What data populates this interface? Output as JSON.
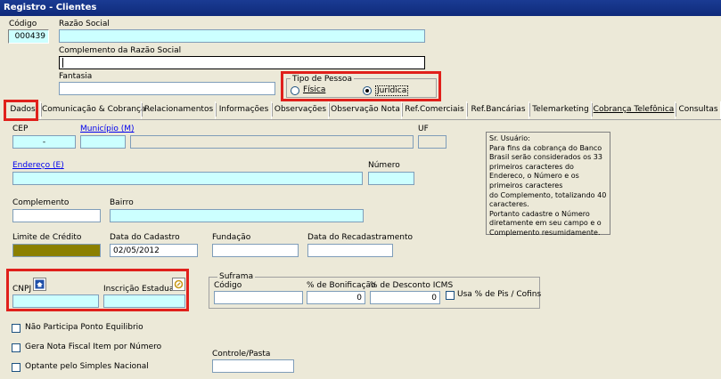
{
  "window": {
    "title": "Registro - Clientes"
  },
  "header": {
    "codigo_label": "Código",
    "codigo_value": "000439",
    "razao_label": "Razão Social",
    "razao_value": "",
    "complemento_razao_label": "Complemento da Razão Social",
    "complemento_razao_value": "",
    "fantasia_label": "Fantasia",
    "fantasia_value": "",
    "tipo_pessoa": {
      "title": "Tipo de Pessoa",
      "fisica_label": "Física",
      "juridica_label": "Jurídica",
      "selected": "Jurídica"
    }
  },
  "tabs": [
    "Dados",
    "Comunicação & Cobrança",
    "Relacionamentos",
    "Informações",
    "Observações",
    "Observação Nota",
    "Ref.Comerciais",
    "Ref.Bancárias",
    "Telemarketing",
    "Cobrança Telefônica",
    "Consultas"
  ],
  "dados": {
    "cep_label": "CEP",
    "cep_value": "-",
    "municipio_label": "Município (M)",
    "municipio_code": "",
    "municipio_name": "",
    "uf_label": "UF",
    "uf_value": "",
    "endereco_label": "Endereço (E)",
    "endereco_value": "",
    "numero_label": "Número",
    "numero_value": "",
    "complemento_label": "Complemento",
    "complemento_value": "",
    "bairro_label": "Bairro",
    "bairro_value": "",
    "limite_label": "Limite de Crédito",
    "data_cadastro_label": "Data do Cadastro",
    "data_cadastro_value": "02/05/2012",
    "fundacao_label": "Fundação",
    "fundacao_value": "",
    "data_recad_label": "Data do Recadastramento",
    "data_recad_value": "",
    "cnpj_label": "CNPJ",
    "cnpj_value": "",
    "ie_label": "Inscrição Estadual",
    "ie_value": "",
    "suframa": {
      "title": "Suframa",
      "codigo_label": "Código",
      "codigo_value": "",
      "bonificacao_label": "% de Bonificação",
      "bonificacao_value": "0",
      "desconto_icms_label": "% de Desconto ICMS",
      "desconto_icms_value": "0",
      "pis_cofins_label": "Usa % de Pis / Cofins"
    },
    "checks": [
      "Não Participa Ponto Equilibrio",
      "Gera Nota Fiscal Item por Número",
      "Optante pelo Simples Nacional"
    ],
    "controle_label": "Controle/Pasta",
    "controle_value": "",
    "note_lines": [
      "Sr. Usuário:",
      "Para fins da cobrança do Banco",
      "Brasil serão considerados os 33",
      "primeiros caracteres do",
      "Endereco, o Número e os",
      "primeiros caracteres",
      "do Complemento, totalizando 40",
      "caracteres.",
      "Portanto cadastre o Número",
      "diretamente em seu campo e o",
      "Complemento resumidamente."
    ]
  },
  "colors": {
    "title_bar": "#0f2a7a",
    "field_cyan": "#ccffff",
    "limite_olive": "#8b8000",
    "highlight_red": "#e0201b",
    "link_blue": "#0000ee"
  }
}
